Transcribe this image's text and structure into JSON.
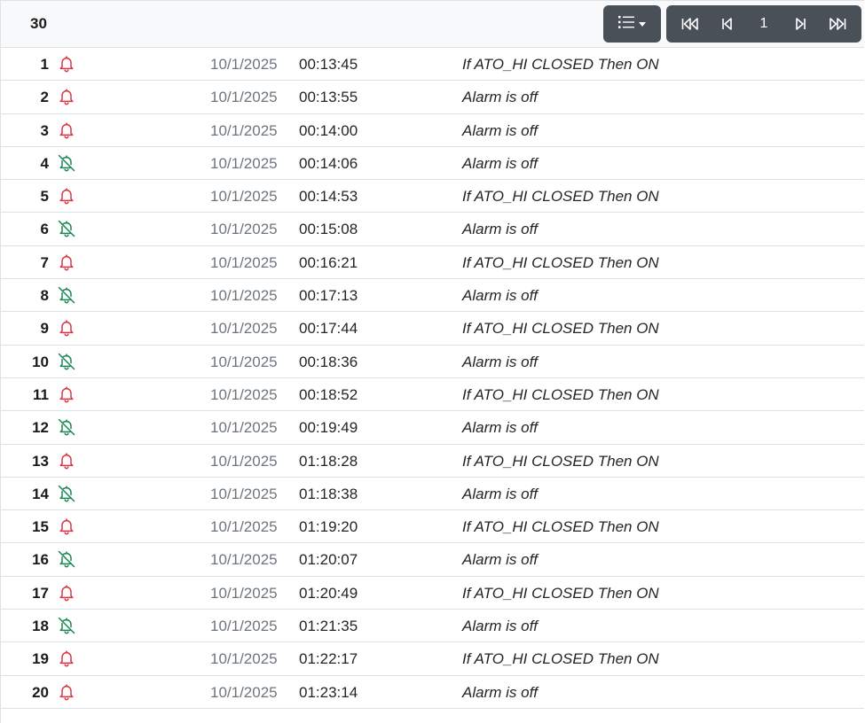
{
  "header": {
    "count": "30",
    "list_menu_icon": "list-icon",
    "pager": {
      "first_icon": "skip-first-icon",
      "prev_icon": "skip-prev-icon",
      "page": "1",
      "next_icon": "skip-next-icon",
      "last_icon": "skip-last-icon"
    }
  },
  "colors": {
    "alarm_on": "#dc3545",
    "alarm_off": "#198754",
    "button_bg": "#495057"
  },
  "rows": [
    {
      "num": "1",
      "icon": "bell-icon",
      "date": "10/1/2025",
      "time": "00:13:45",
      "message": "If ATO_HI CLOSED Then ON"
    },
    {
      "num": "2",
      "icon": "bell-icon",
      "date": "10/1/2025",
      "time": "00:13:55",
      "message": "Alarm is off"
    },
    {
      "num": "3",
      "icon": "bell-icon",
      "date": "10/1/2025",
      "time": "00:14:00",
      "message": "Alarm is off"
    },
    {
      "num": "4",
      "icon": "bell-slash-icon",
      "date": "10/1/2025",
      "time": "00:14:06",
      "message": "Alarm is off"
    },
    {
      "num": "5",
      "icon": "bell-icon",
      "date": "10/1/2025",
      "time": "00:14:53",
      "message": "If ATO_HI CLOSED Then ON"
    },
    {
      "num": "6",
      "icon": "bell-slash-icon",
      "date": "10/1/2025",
      "time": "00:15:08",
      "message": "Alarm is off"
    },
    {
      "num": "7",
      "icon": "bell-icon",
      "date": "10/1/2025",
      "time": "00:16:21",
      "message": "If ATO_HI CLOSED Then ON"
    },
    {
      "num": "8",
      "icon": "bell-slash-icon",
      "date": "10/1/2025",
      "time": "00:17:13",
      "message": "Alarm is off"
    },
    {
      "num": "9",
      "icon": "bell-icon",
      "date": "10/1/2025",
      "time": "00:17:44",
      "message": "If ATO_HI CLOSED Then ON"
    },
    {
      "num": "10",
      "icon": "bell-slash-icon",
      "date": "10/1/2025",
      "time": "00:18:36",
      "message": "Alarm is off"
    },
    {
      "num": "11",
      "icon": "bell-icon",
      "date": "10/1/2025",
      "time": "00:18:52",
      "message": "If ATO_HI CLOSED Then ON"
    },
    {
      "num": "12",
      "icon": "bell-slash-icon",
      "date": "10/1/2025",
      "time": "00:19:49",
      "message": "Alarm is off"
    },
    {
      "num": "13",
      "icon": "bell-icon",
      "date": "10/1/2025",
      "time": "01:18:28",
      "message": "If ATO_HI CLOSED Then ON"
    },
    {
      "num": "14",
      "icon": "bell-slash-icon",
      "date": "10/1/2025",
      "time": "01:18:38",
      "message": "Alarm is off"
    },
    {
      "num": "15",
      "icon": "bell-icon",
      "date": "10/1/2025",
      "time": "01:19:20",
      "message": "If ATO_HI CLOSED Then ON"
    },
    {
      "num": "16",
      "icon": "bell-slash-icon",
      "date": "10/1/2025",
      "time": "01:20:07",
      "message": "Alarm is off"
    },
    {
      "num": "17",
      "icon": "bell-icon",
      "date": "10/1/2025",
      "time": "01:20:49",
      "message": "If ATO_HI CLOSED Then ON"
    },
    {
      "num": "18",
      "icon": "bell-slash-icon",
      "date": "10/1/2025",
      "time": "01:21:35",
      "message": "Alarm is off"
    },
    {
      "num": "19",
      "icon": "bell-icon",
      "date": "10/1/2025",
      "time": "01:22:17",
      "message": "If ATO_HI CLOSED Then ON"
    },
    {
      "num": "20",
      "icon": "bell-icon",
      "date": "10/1/2025",
      "time": "01:23:14",
      "message": "Alarm is off"
    }
  ]
}
